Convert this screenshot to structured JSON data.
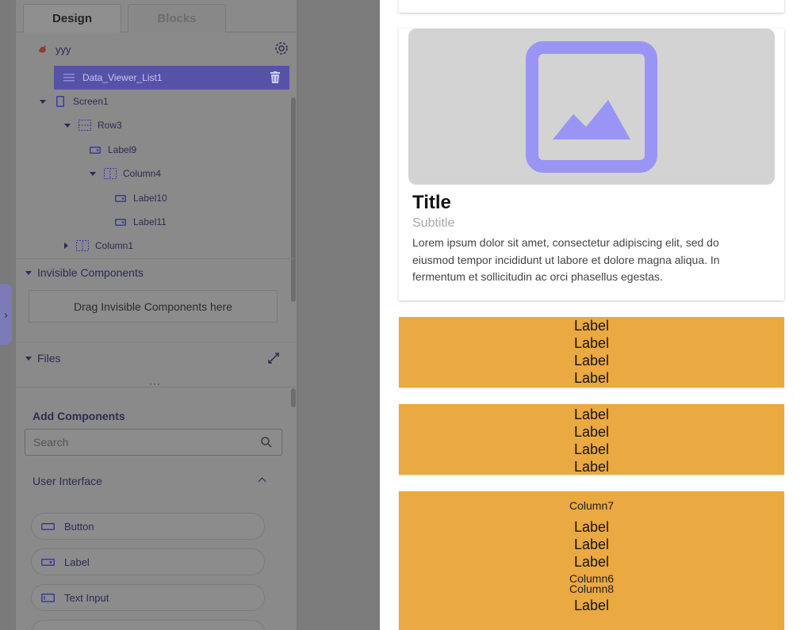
{
  "tabs": {
    "design": "Design",
    "blocks": "Blocks"
  },
  "tree": {
    "project": "yyy",
    "selected": "Data_Viewer_List1",
    "screen": "Screen1",
    "row3": "Row3",
    "label9": "Label9",
    "column4": "Column4",
    "label10": "Label10",
    "label11": "Label11",
    "column1": "Column1"
  },
  "invisible": {
    "title": "Invisible Components",
    "drop_text": "Drag Invisible Components here"
  },
  "files": {
    "title": "Files",
    "dots": "···"
  },
  "add_components": {
    "title": "Add Components",
    "search_placeholder": "Search",
    "category": "User Interface",
    "items": [
      "Button",
      "Label",
      "Text Input"
    ]
  },
  "preview": {
    "card": {
      "title": "Title",
      "subtitle": "Subtitle",
      "body": "Lorem ipsum dolor sit amet, consectetur adipiscing elit, sed do eiusmod tempor incididunt ut labore et dolore magna aliqua. In fermentum et sollicitudin ac orci phasellus egestas."
    },
    "block1": [
      "Label",
      "Label",
      "Label",
      "Label"
    ],
    "block2": [
      "Label",
      "Label",
      "Label",
      "Label"
    ],
    "block3": {
      "column7": "Column7",
      "labels": [
        "Label",
        "Label",
        "Label"
      ],
      "column6": "Column6",
      "column8": "Column8",
      "label_last": "Label"
    }
  },
  "colors": {
    "accent": "#5652a8",
    "orange": "#eaa941",
    "image_icon": "#9a95f5"
  },
  "icons": {
    "settings": "gear-icon",
    "delete": "trash-icon",
    "search": "search-icon",
    "expand": "expand-icon",
    "drawer": "chevron-right-icon"
  }
}
